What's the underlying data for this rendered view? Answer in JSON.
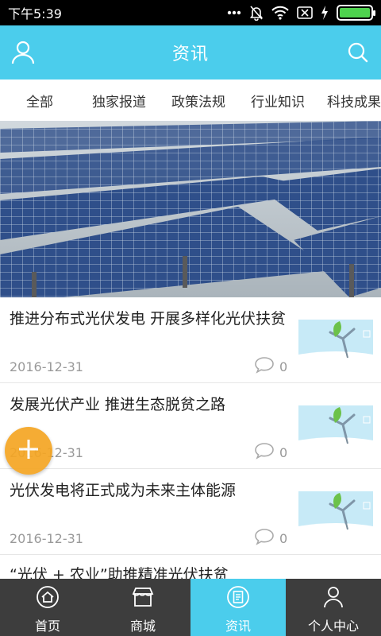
{
  "status": {
    "time": "下午5:39"
  },
  "appbar": {
    "title": "资讯"
  },
  "tabs": [
    "全部",
    "独家报道",
    "政策法规",
    "行业知识",
    "科技成果"
  ],
  "articles": [
    {
      "title": "推进分布式光伏发电 开展多样化光伏扶贫",
      "date": "2016-12-31",
      "comments": "0"
    },
    {
      "title": "发展光伏产业 推进生态脱贫之路",
      "date": "2016-12-31",
      "comments": "0"
    },
    {
      "title": "光伏发电将正式成为未来主体能源",
      "date": "2016-12-31",
      "comments": "0"
    },
    {
      "title": "“光伏 + 农业”助推精准光伏扶贫"
    }
  ],
  "bottom_nav": [
    {
      "label": "首页",
      "icon": "home-icon"
    },
    {
      "label": "商城",
      "icon": "store-icon"
    },
    {
      "label": "资讯",
      "icon": "news-icon",
      "active": true
    },
    {
      "label": "个人中心",
      "icon": "person-icon"
    }
  ],
  "colors": {
    "accent": "#4bcdec",
    "nav_bg": "#3d3d3d",
    "fab": "#f5a623"
  }
}
